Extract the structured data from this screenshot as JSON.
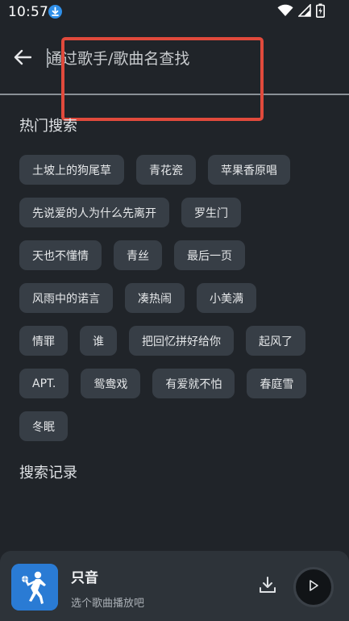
{
  "status_bar": {
    "time": "10:57",
    "icons": [
      "download-icon",
      "wifi-icon",
      "signal-icon",
      "battery-charging-icon"
    ]
  },
  "search": {
    "placeholder": "通过歌手/歌曲名查找",
    "value": "",
    "icons": [
      "back-arrow-icon"
    ]
  },
  "hot_search": {
    "title": "热门搜索",
    "rows": [
      [
        "土坡上的狗尾草",
        "青花瓷",
        "苹果香原唱"
      ],
      [
        "先说爱的人为什么先离开",
        "罗生门"
      ],
      [
        "天也不懂情",
        "青丝",
        "最后一页"
      ],
      [
        "风雨中的诺言",
        "凑热闹",
        "小美满"
      ],
      [
        "情罪",
        "谁",
        "把回忆拼好给你",
        "起风了"
      ],
      [
        "APT.",
        "鸳鸯戏",
        "有爱就不怕",
        "春庭雪"
      ],
      [
        "冬眠"
      ]
    ]
  },
  "history": {
    "title": "搜索记录"
  },
  "player": {
    "title": "只音",
    "subtitle": "选个歌曲播放吧",
    "icons": [
      "basketball-player-icon",
      "download-icon",
      "play-icon"
    ]
  },
  "colors": {
    "background": "#202429",
    "tag_bg": "#373e46",
    "player_bg": "#2d3339",
    "accent_blue": "#2a7bd4",
    "annotation_red": "#e14a3c"
  }
}
